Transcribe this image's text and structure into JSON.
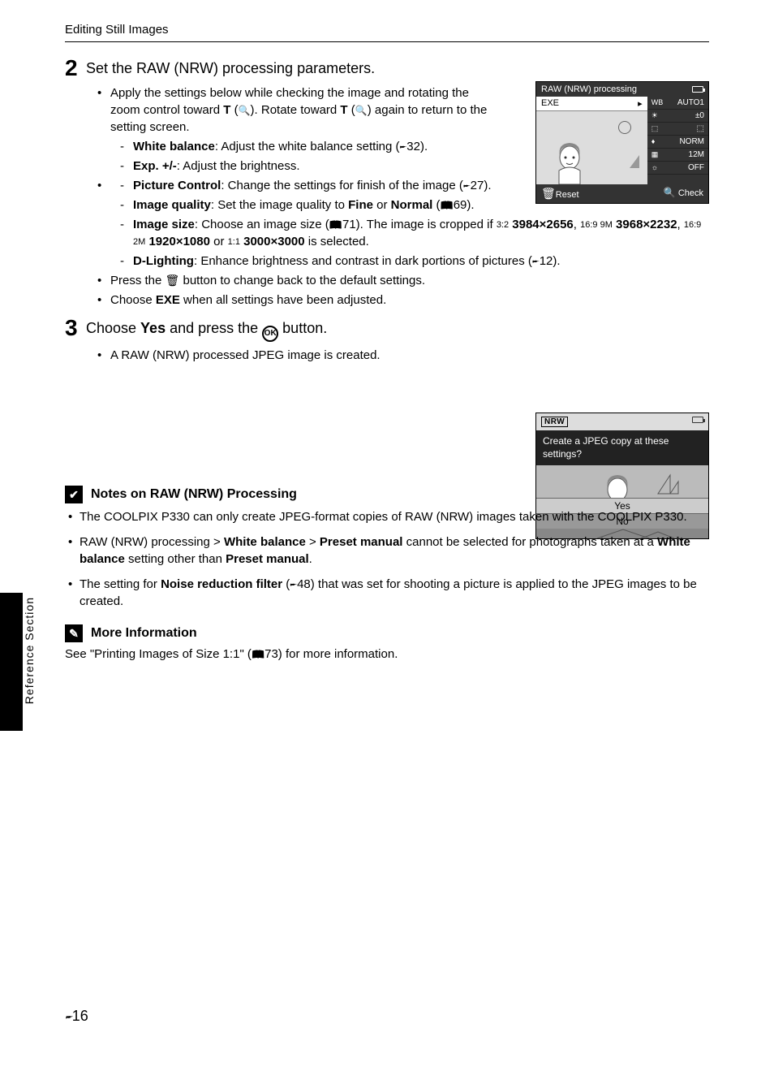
{
  "header": {
    "title": "Editing Still Images"
  },
  "step2": {
    "num": "2",
    "title": "Set the RAW (NRW) processing parameters.",
    "intro": "Apply the settings below while checking the image and rotating the zoom control toward ",
    "intro2": "). Rotate toward ",
    "intro3": ") again to return to the setting screen.",
    "tele": "T",
    "wb_label": "White balance",
    "wb_text": ": Adjust the white balance setting (",
    "wb_ref": "32).",
    "exp_label": "Exp. +/-",
    "exp_text": ": Adjust the brightness.",
    "pc_label": "Picture Control",
    "pc_text": ": Change the settings for finish of the image (",
    "pc_ref": "27).",
    "iq_label": "Image quality",
    "iq_text": ": Set the image quality to ",
    "iq_fine": "Fine",
    "iq_or": " or ",
    "iq_norm": "Normal",
    "iq_ref": "69).",
    "is_label": "Image size",
    "is_text": ": Choose an image size (",
    "is_ref": "71). The image is cropped if ",
    "is_s1": "3984×2656",
    "is_s2": "3968×2232",
    "is_s3": "1920×1080",
    "is_or": " or ",
    "is_s4": "3000×3000",
    "is_end": " is selected.",
    "dl_label": "D-Lighting",
    "dl_text": ": Enhance brightness and contrast in dark portions of pictures (",
    "dl_ref": "12).",
    "trash": "Press the ",
    "trash2": " button to change back to the default settings.",
    "exe": "Choose ",
    "exe_b": "EXE",
    "exe2": " when all settings have been adjusted."
  },
  "step3": {
    "num": "3",
    "pre": "Choose ",
    "yes": "Yes",
    "mid": " and press the ",
    "ok": "OK",
    "post": " button.",
    "bullet": "A RAW (NRW) processed JPEG image is created."
  },
  "cam1": {
    "title": "RAW (NRW) processing",
    "exe": "EXE",
    "r1a": "WB",
    "r1b": "AUTO1",
    "r2a": "☀",
    "r2b": "±0",
    "r3a": "⬚",
    "r3b": "⬚",
    "r4a": "♦",
    "r4b": "NORM",
    "r5a": "▦",
    "r5b": "12M",
    "r6a": "☼",
    "r6b": "OFF",
    "reset": "Reset",
    "check": "Check"
  },
  "cam2": {
    "nrw": "NRW",
    "msg": "Create a JPEG copy at these settings?",
    "yes": "Yes",
    "no": "No"
  },
  "notes": {
    "title": "Notes on RAW (NRW) Processing",
    "n1": "The COOLPIX P330 can only create JPEG-format copies of RAW (NRW) images taken with the COOLPIX P330.",
    "n2a": "RAW (NRW) processing > ",
    "n2b": "White balance",
    "n2c": " > ",
    "n2d": "Preset manual",
    "n2e": " cannot be selected for photographs taken at a ",
    "n2f": "White balance",
    "n2g": " setting other than ",
    "n2h": "Preset manual",
    "n2i": ".",
    "n3a": "The setting for ",
    "n3b": "Noise reduction filter",
    "n3c": " (",
    "n3d": "48) that was set for shooting a picture is applied to the JPEG images to be created."
  },
  "more": {
    "title": "More Information",
    "text_a": "See \"Printing Images of Size 1:1\" (",
    "text_b": "73) for more information."
  },
  "side": {
    "label": "Reference Section"
  },
  "footer": {
    "page": "16"
  }
}
